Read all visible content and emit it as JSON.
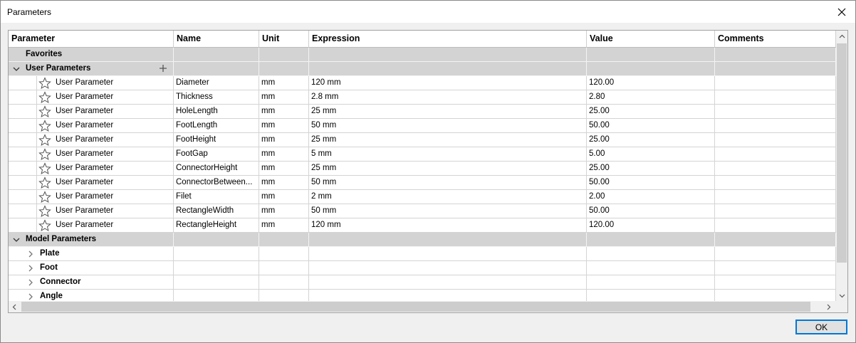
{
  "window": {
    "title": "Parameters",
    "ok_label": "OK"
  },
  "columns": [
    "Parameter",
    "Name",
    "Unit",
    "Expression",
    "Value",
    "Comments"
  ],
  "groups": {
    "favorites": "Favorites",
    "user": "User Parameters",
    "model": "Model Parameters"
  },
  "user_params": [
    {
      "type": "User Parameter",
      "name": "Diameter",
      "unit": "mm",
      "expression": "120 mm",
      "value": "120.00"
    },
    {
      "type": "User Parameter",
      "name": "Thickness",
      "unit": "mm",
      "expression": "2.8 mm",
      "value": "2.80"
    },
    {
      "type": "User Parameter",
      "name": "HoleLength",
      "unit": "mm",
      "expression": "25 mm",
      "value": "25.00"
    },
    {
      "type": "User Parameter",
      "name": "FootLength",
      "unit": "mm",
      "expression": "50 mm",
      "value": "50.00"
    },
    {
      "type": "User Parameter",
      "name": "FootHeight",
      "unit": "mm",
      "expression": "25 mm",
      "value": "25.00"
    },
    {
      "type": "User Parameter",
      "name": "FootGap",
      "unit": "mm",
      "expression": "5 mm",
      "value": "5.00"
    },
    {
      "type": "User Parameter",
      "name": "ConnectorHeight",
      "unit": "mm",
      "expression": "25 mm",
      "value": "25.00"
    },
    {
      "type": "User Parameter",
      "name": "ConnectorBetween...",
      "unit": "mm",
      "expression": "50 mm",
      "value": "50.00"
    },
    {
      "type": "User Parameter",
      "name": "Filet",
      "unit": "mm",
      "expression": "2 mm",
      "value": "2.00"
    },
    {
      "type": "User Parameter",
      "name": "RectangleWidth",
      "unit": "mm",
      "expression": "50 mm",
      "value": "50.00"
    },
    {
      "type": "User Parameter",
      "name": "RectangleHeight",
      "unit": "mm",
      "expression": "120 mm",
      "value": "120.00"
    }
  ],
  "model_items": [
    "Plate",
    "Foot",
    "Connector",
    "Angle"
  ],
  "icons": {
    "close": "close-icon",
    "star": "star-outline-icon",
    "chevron_down": "chevron-down-icon",
    "chevron_right": "chevron-right-icon",
    "plus": "plus-icon"
  }
}
